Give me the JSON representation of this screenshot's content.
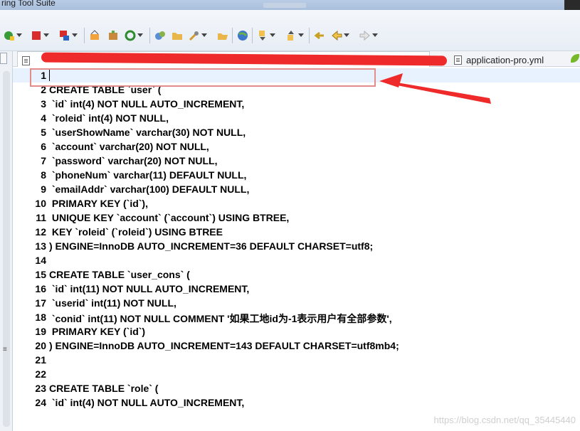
{
  "window": {
    "title": "ring Tool Suite"
  },
  "toolbar": {
    "icons": [
      "new-icon",
      "stop-icon",
      "debug-icon",
      "build-icon",
      "package-icon",
      "refresh-icon",
      "run-icon",
      "folder-icon",
      "open-icon",
      "tools-icon",
      "open-folder-icon",
      "globe-icon",
      "next-annotation-icon",
      "prev-annotation-icon",
      "back-icon",
      "forward-icon"
    ]
  },
  "tabs": {
    "items": [
      {
        "label": "application-pro.yml"
      }
    ]
  },
  "editor": {
    "lines": [
      {
        "n": "1",
        "text": ""
      },
      {
        "n": "2",
        "text": "CREATE TABLE `user` ("
      },
      {
        "n": "3",
        "text": " `id` int(4) NOT NULL AUTO_INCREMENT,"
      },
      {
        "n": "4",
        "text": " `roleid` int(4) NOT NULL,"
      },
      {
        "n": "5",
        "text": " `userShowName` varchar(30) NOT NULL,"
      },
      {
        "n": "6",
        "text": " `account` varchar(20) NOT NULL,"
      },
      {
        "n": "7",
        "text": " `password` varchar(20) NOT NULL,"
      },
      {
        "n": "8",
        "text": " `phoneNum` varchar(11) DEFAULT NULL,"
      },
      {
        "n": "9",
        "text": " `emailAddr` varchar(100) DEFAULT NULL,"
      },
      {
        "n": "10",
        "text": " PRIMARY KEY (`id`),"
      },
      {
        "n": "11",
        "text": " UNIQUE KEY `account` (`account`) USING BTREE,"
      },
      {
        "n": "12",
        "text": " KEY `roleid` (`roleid`) USING BTREE"
      },
      {
        "n": "13",
        "text": ") ENGINE=InnoDB AUTO_INCREMENT=36 DEFAULT CHARSET=utf8;"
      },
      {
        "n": "14",
        "text": ""
      },
      {
        "n": "15",
        "text": "CREATE TABLE `user_cons` ("
      },
      {
        "n": "16",
        "text": " `id` int(11) NOT NULL AUTO_INCREMENT,"
      },
      {
        "n": "17",
        "text": " `userid` int(11) NOT NULL,"
      },
      {
        "n": "18",
        "text": " `conid` int(11) NOT NULL COMMENT '如果工地id为-1表示用户有全部参数',"
      },
      {
        "n": "19",
        "text": " PRIMARY KEY (`id`)"
      },
      {
        "n": "20",
        "text": ") ENGINE=InnoDB AUTO_INCREMENT=143 DEFAULT CHARSET=utf8mb4;"
      },
      {
        "n": "21",
        "text": ""
      },
      {
        "n": "22",
        "text": ""
      },
      {
        "n": "23",
        "text": "CREATE TABLE `role` ("
      },
      {
        "n": "24",
        "text": " `id` int(4) NOT NULL AUTO_INCREMENT,"
      }
    ]
  },
  "watermark": "https://blog.csdn.net/qq_35445440",
  "colors": {
    "annotation": "#ef2a2a",
    "current_line": "#e8f2fe"
  }
}
